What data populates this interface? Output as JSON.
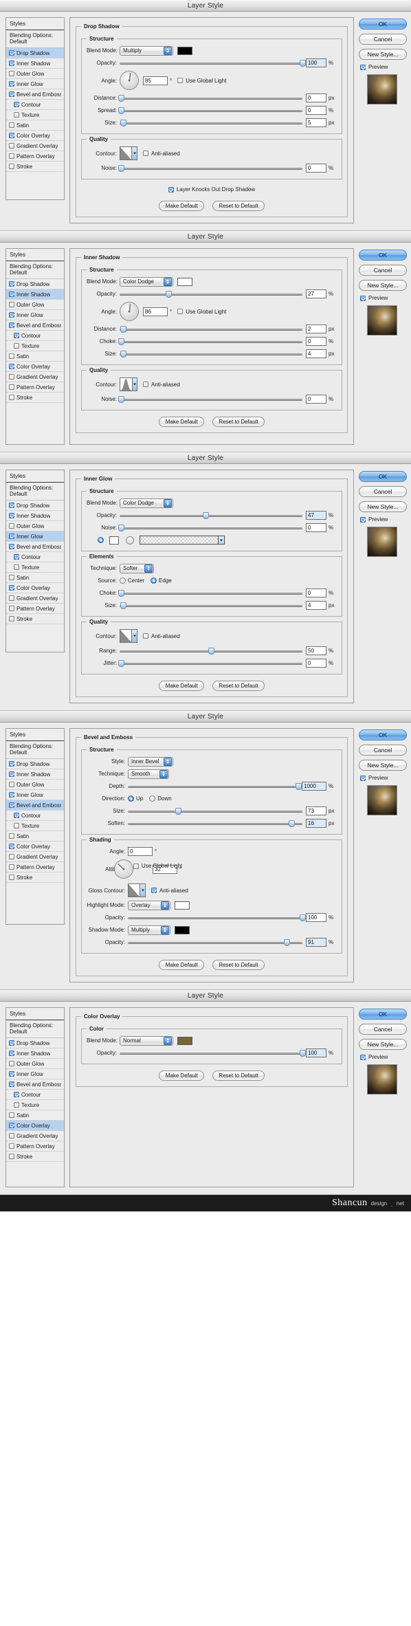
{
  "window_title": "Layer Style",
  "styles_panel": {
    "header": "Styles",
    "blending_options": "Blending Options: Default",
    "items": [
      {
        "label": "Drop Shadow",
        "checked": true,
        "indent": false
      },
      {
        "label": "Inner Shadow",
        "checked": true,
        "indent": false
      },
      {
        "label": "Outer Glow",
        "checked": false,
        "indent": false
      },
      {
        "label": "Inner Glow",
        "checked": true,
        "indent": false
      },
      {
        "label": "Bevel and Emboss",
        "checked": true,
        "indent": false
      },
      {
        "label": "Contour",
        "checked": true,
        "indent": true
      },
      {
        "label": "Texture",
        "checked": false,
        "indent": true
      },
      {
        "label": "Satin",
        "checked": false,
        "indent": false
      },
      {
        "label": "Color Overlay",
        "checked": true,
        "indent": false
      },
      {
        "label": "Gradient Overlay",
        "checked": false,
        "indent": false
      },
      {
        "label": "Pattern Overlay",
        "checked": false,
        "indent": false
      },
      {
        "label": "Stroke",
        "checked": false,
        "indent": false
      }
    ]
  },
  "buttons": {
    "ok": "OK",
    "cancel": "Cancel",
    "new_style": "New Style...",
    "preview": "Preview",
    "make_default": "Make Default",
    "reset_to_default": "Reset to Default"
  },
  "labels": {
    "structure": "Structure",
    "quality": "Quality",
    "elements": "Elements",
    "shading": "Shading",
    "color": "Color",
    "blend_mode": "Blend Mode:",
    "opacity": "Opacity:",
    "angle": "Angle:",
    "distance": "Distance:",
    "spread": "Spread:",
    "size": "Size:",
    "contour": "Contour:",
    "noise": "Noise:",
    "choke": "Choke:",
    "technique": "Technique:",
    "source": "Source:",
    "range": "Range:",
    "jitter": "Jitter:",
    "style": "Style:",
    "depth": "Depth:",
    "direction": "Direction:",
    "soften": "Soften:",
    "altitude": "Altitude:",
    "gloss_contour": "Gloss Contour:",
    "highlight_mode": "Highlight Mode:",
    "shadow_mode": "Shadow Mode:",
    "anti_aliased": "Anti-aliased",
    "use_global_light": "Use Global Light",
    "layer_knocks_out": "Layer Knocks Out Drop Shadow",
    "center": "Center",
    "edge": "Edge",
    "up": "Up",
    "down": "Down",
    "unit_pct": "%",
    "unit_px": "px",
    "degree": "°"
  },
  "panels": [
    {
      "id": "drop-shadow",
      "section_title": "Drop Shadow",
      "selected_style": "Drop Shadow",
      "blend_mode": "Multiply",
      "blend_color": "#000000",
      "opacity": "100",
      "angle": "85",
      "angle_deg": 85,
      "use_global_light": false,
      "distance": "0",
      "spread": "0",
      "size": "5",
      "noise": "0",
      "anti_aliased": false,
      "layer_knocks_out": true,
      "contour_shape": "linear"
    },
    {
      "id": "inner-shadow",
      "section_title": "Inner Shadow",
      "selected_style": "Inner Shadow",
      "blend_mode": "Color Dodge",
      "blend_color": "#ffffff",
      "opacity": "27",
      "angle": "86",
      "angle_deg": 86,
      "use_global_light": false,
      "distance": "2",
      "choke": "0",
      "size": "4",
      "noise": "0",
      "anti_aliased": false,
      "contour_shape": "gaussian"
    },
    {
      "id": "inner-glow",
      "section_title": "Inner Glow",
      "selected_style": "Inner Glow",
      "blend_mode": "Color Dodge",
      "opacity": "47",
      "noise": "0",
      "technique": "Softer",
      "source": "Edge",
      "choke": "0",
      "size": "4",
      "range": "50",
      "jitter": "0",
      "anti_aliased": false,
      "contour_shape": "linear"
    },
    {
      "id": "bevel-and-emboss",
      "section_title": "Bevel and Emboss",
      "selected_style": "Bevel and Emboss",
      "style": "Inner Bevel",
      "technique": "Smooth",
      "depth": "1000",
      "direction": "Up",
      "size": "73",
      "soften": "16",
      "angle": "0",
      "angle_deg": 0,
      "use_global_light": false,
      "altitude": "32",
      "gloss_anti_aliased": true,
      "highlight_mode": "Overlay",
      "highlight_color": "#ffffff",
      "highlight_opacity": "100",
      "shadow_mode": "Multiply",
      "shadow_color": "#000000",
      "shadow_opacity": "91"
    },
    {
      "id": "color-overlay",
      "section_title": "Color Overlay",
      "selected_style": "Color Overlay",
      "blend_mode": "Normal",
      "blend_color": "#7a6432",
      "opacity": "100"
    }
  ],
  "watermark": {
    "main": "Shancun",
    "sub": "design",
    "net": "net",
    "dot": "."
  }
}
